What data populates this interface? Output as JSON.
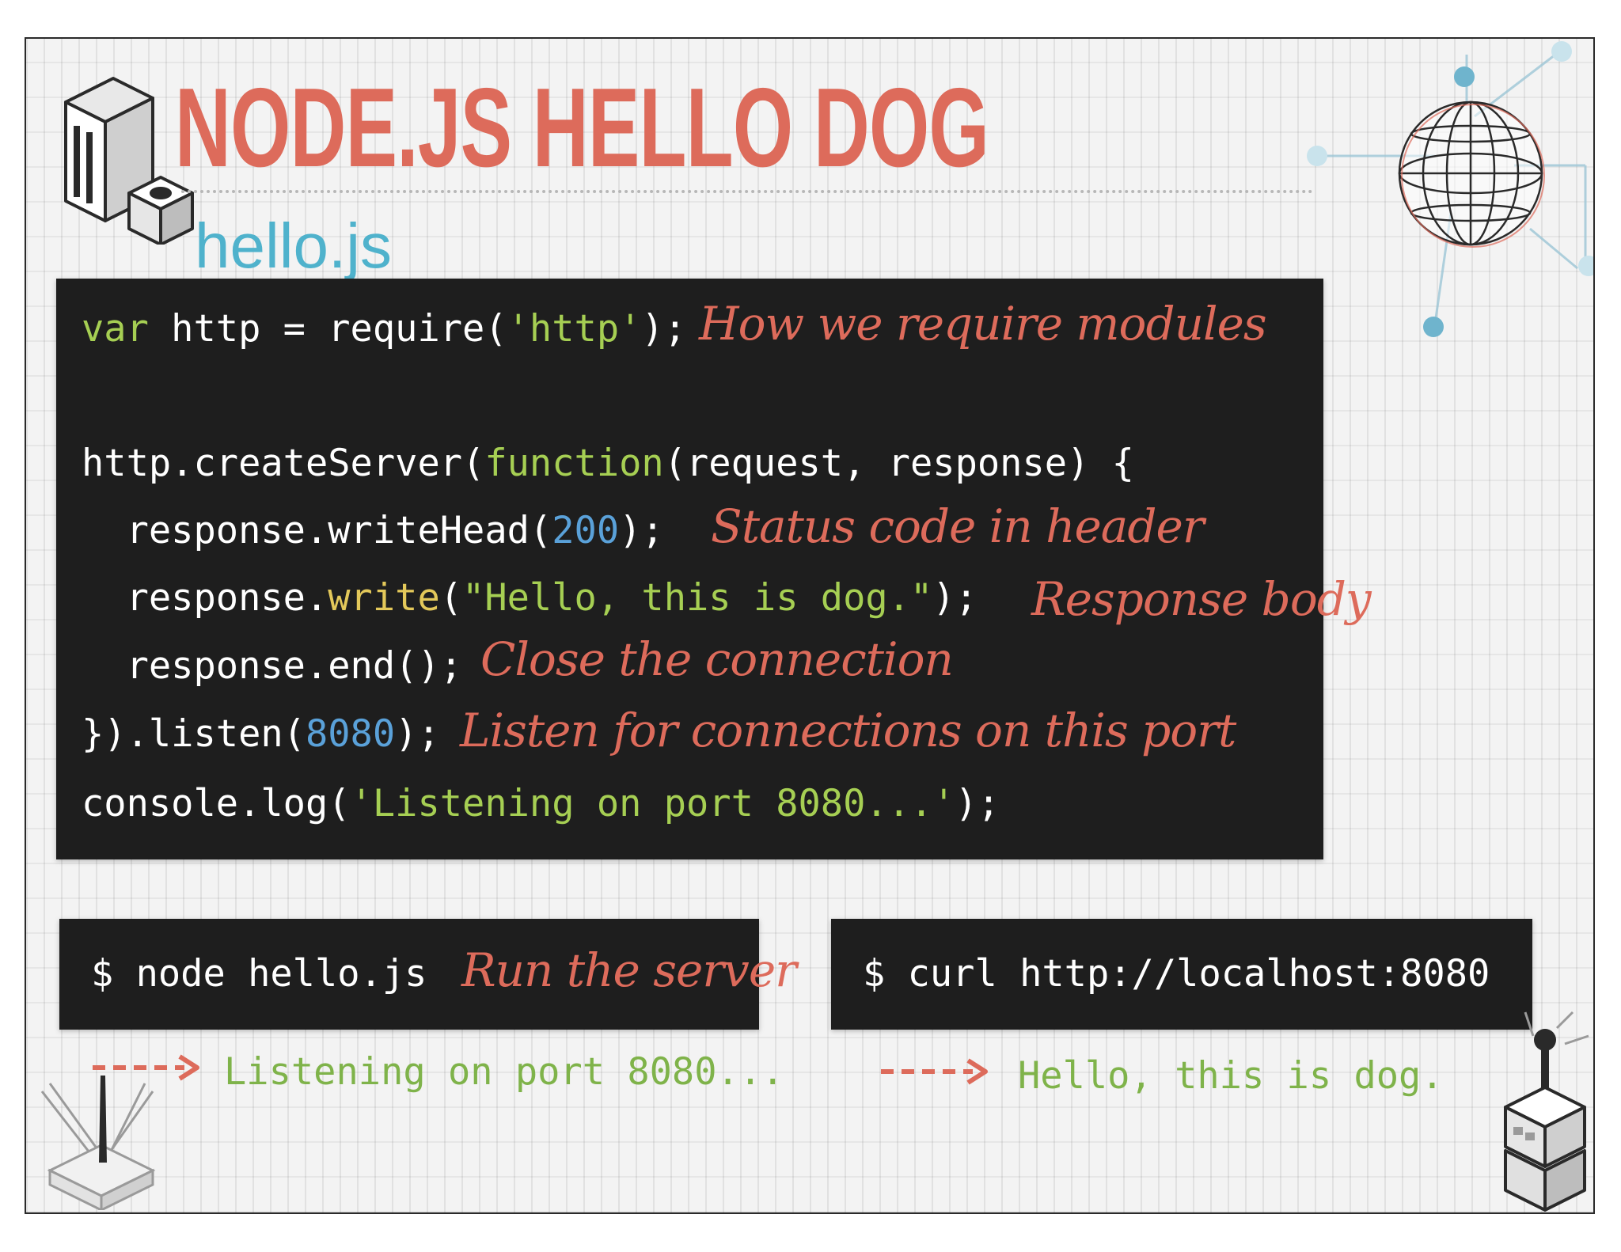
{
  "slide": {
    "title": "NODE.JS HELLO DOG",
    "filename": "hello.js"
  },
  "code": {
    "line1": {
      "kw": "var",
      "mid": " http = require(",
      "str": "'http'",
      "end": ");"
    },
    "line3": {
      "pre": "http.createServer(",
      "kw": "function",
      "end": "(request, response) {"
    },
    "line4": {
      "pre": "  response.writeHead(",
      "num": "200",
      "end": ");"
    },
    "line5": {
      "pre": "  response.",
      "fn": "write",
      "paren": "(",
      "str": "\"Hello, this is dog.\"",
      "end": ");"
    },
    "line6": {
      "text": "  response.end();"
    },
    "line7": {
      "pre": "}).listen(",
      "num": "8080",
      "end": ");"
    },
    "line8": {
      "pre": "console.log(",
      "str": "'Listening on port 8080...'",
      "end": ");"
    }
  },
  "annotations": {
    "require": "How we require modules",
    "status": "Status code in header",
    "body": "Response body",
    "close": "Close the connection",
    "listen": "Listen for connections on this port",
    "run": "Run the server"
  },
  "terminal": {
    "node_cmd": "$ node hello.js",
    "curl_cmd": "$ curl http://localhost:8080",
    "node_output": "Listening on port 8080...",
    "curl_output": "Hello, this is dog."
  },
  "colors": {
    "accent": "#dd6b5b",
    "filename": "#4fb2cc",
    "keyword": "#a6cf53",
    "number": "#5aa1d9",
    "output": "#7fb34a",
    "code_bg": "#1e1e1e"
  },
  "icons": [
    "server-tower-icon",
    "globe-network-icon",
    "robot-arm-icon",
    "antenna-server-icon",
    "arrow-right-icon"
  ]
}
